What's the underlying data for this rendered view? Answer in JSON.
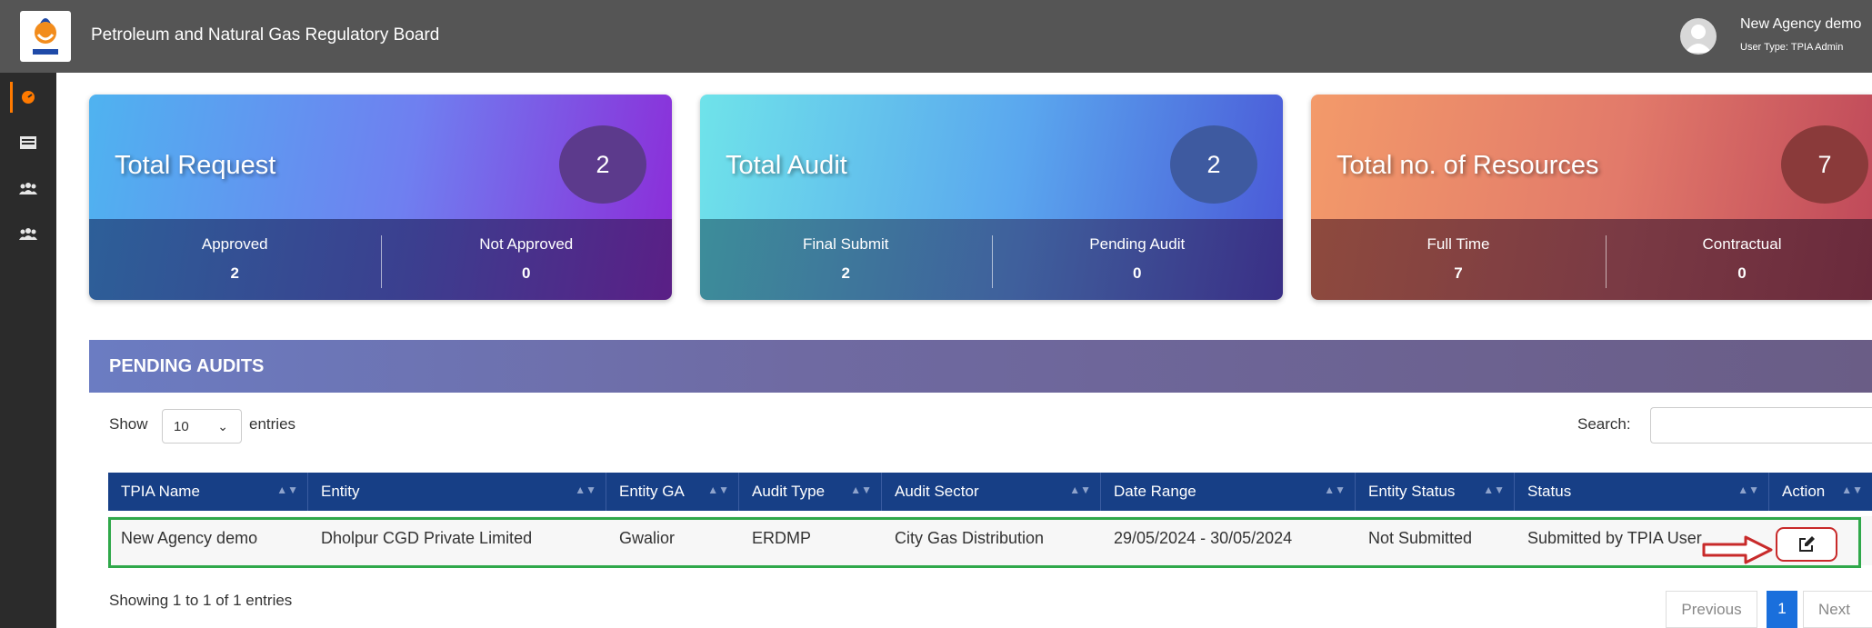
{
  "header": {
    "title": "Petroleum and Natural Gas Regulatory Board",
    "user_name": "New Agency demo",
    "user_type": "User Type: TPIA Admin"
  },
  "sidebar": {
    "items": [
      {
        "icon": "dashboard-icon"
      },
      {
        "icon": "list-icon"
      },
      {
        "icon": "users-icon"
      },
      {
        "icon": "users-icon"
      }
    ]
  },
  "cards": [
    {
      "title": "Total Request",
      "count": "2",
      "stats": [
        {
          "label": "Approved",
          "value": "2"
        },
        {
          "label": "Not Approved",
          "value": "0"
        }
      ],
      "colors": {
        "top": "#4fb3f0",
        "accent": "#8b2fd9"
      }
    },
    {
      "title": "Total Audit",
      "count": "2",
      "stats": [
        {
          "label": "Final Submit",
          "value": "2"
        },
        {
          "label": "Pending Audit",
          "value": "0"
        }
      ],
      "colors": {
        "top": "#6fe3ea",
        "accent": "#4b5bd8"
      }
    },
    {
      "title": "Total no. of Resources",
      "count": "7",
      "stats": [
        {
          "label": "Full Time",
          "value": "7"
        },
        {
          "label": "Contractual",
          "value": "0"
        }
      ],
      "colors": {
        "top": "#f39a6a",
        "accent": "#c04a5a"
      }
    }
  ],
  "pending": {
    "heading": "PENDING AUDITS",
    "show_label": "Show",
    "entries_value": "10",
    "entries_label": "entries",
    "search_label": "Search:",
    "search_value": "",
    "columns": [
      "TPIA Name",
      "Entity",
      "Entity GA",
      "Audit Type",
      "Audit Sector",
      "Date Range",
      "Entity Status",
      "Status",
      "Action"
    ],
    "rows": [
      [
        "New Agency demo",
        "Dholpur CGD Private Limited",
        "Gwalior",
        "ERDMP",
        "City Gas Distribution",
        "29/05/2024 - 30/05/2024",
        "Not Submitted",
        "Submitted by TPIA User"
      ]
    ],
    "info": "Showing 1 to 1 of 1 entries",
    "pagination": {
      "previous": "Previous",
      "current": "1",
      "next": "Next"
    }
  },
  "colors": {
    "table_header": "#173f86",
    "highlight_border": "#2fa84a",
    "annotation_red": "#c82a2a",
    "page_active": "#1a6fdc"
  }
}
